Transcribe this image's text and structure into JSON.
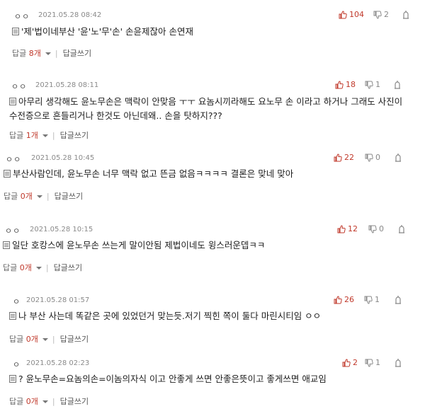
{
  "comments": [
    {
      "user": "ㅇㅇ",
      "date": "2021.05.28 08:42",
      "likes": "104",
      "dislikes": "2",
      "text": "'제'법이네부산 '윤'노'무'손' 손윤제잖아 손연재",
      "reply_label": "답글",
      "reply_count": "8개",
      "write_label": "답글쓰기"
    },
    {
      "user": "ㅇㅇ",
      "date": "2021.05.28 08:11",
      "likes": "18",
      "dislikes": "1",
      "text_line1": "아무리 생각해도 윤노무손은 맥락이 안맞음 ㅜㅜ 요놈시끼라해도 요노무 손 이라고 하거나 그래도 사진이",
      "text_line2": "수전증으로 흔들리거나 한것도 아닌데왜.. 손을 탓하지???",
      "reply_label": "답글",
      "reply_count": "1개",
      "write_label": "답글쓰기"
    },
    {
      "user": "ㅇㅇ",
      "date": "2021.05.28 10:45",
      "likes": "22",
      "dislikes": "0",
      "text": "부산사람인데, 윤노무손 너무 맥락 없고 뜬금 없음ㅋㅋㅋㅋ 결론은 맞네 맞아",
      "reply_label": "답글",
      "reply_count": "0개",
      "write_label": "답글쓰기"
    },
    {
      "user": "ㅇㅇ",
      "date": "2021.05.28 10:15",
      "likes": "12",
      "dislikes": "0",
      "text": "일단 호캉스에 윤노무손 쓰는게 말이안됨 제법이네도 윙스러운뎁ㅋㅋ",
      "reply_label": "답글",
      "reply_count": "0개",
      "write_label": "답글쓰기"
    },
    {
      "user": "ㅇ",
      "date": "2021.05.28 01:57",
      "likes": "26",
      "dislikes": "1",
      "text": "나 부산 사는데 똑같은 곳에 있었던거 맞는듯.저기 찍힌 쪽이 둘다 마린시티임 ㅇㅇ",
      "reply_label": "답글",
      "reply_count": "0개",
      "write_label": "답글쓰기"
    },
    {
      "user": "ㅇ",
      "date": "2021.05.28 02:23",
      "likes": "2",
      "dislikes": "1",
      "text": "? 윤노무손=요놈의손=이놈의자식 이고 안좋게 쓰면 안좋은뜻이고 좋게쓰면 애교임",
      "reply_label": "답글",
      "reply_count": "0개",
      "write_label": "답글쓰기"
    }
  ]
}
